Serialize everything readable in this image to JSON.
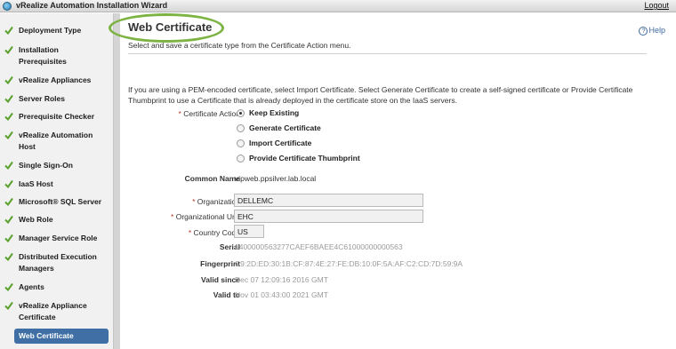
{
  "titlebar": {
    "app_title": "vRealize Automation Installation Wizard",
    "logout": "Logout"
  },
  "sidebar": {
    "items": [
      {
        "label": "Deployment Type",
        "completed": true
      },
      {
        "label": "Installation Prerequisites",
        "completed": true
      },
      {
        "label": "vRealize Appliances",
        "completed": true
      },
      {
        "label": "Server Roles",
        "completed": true
      },
      {
        "label": "Prerequisite Checker",
        "completed": true
      },
      {
        "label": "vRealize Automation Host",
        "completed": true
      },
      {
        "label": "Single Sign-On",
        "completed": true
      },
      {
        "label": "IaaS Host",
        "completed": true
      },
      {
        "label": "Microsoft® SQL Server",
        "completed": true
      },
      {
        "label": "Web Role",
        "completed": true
      },
      {
        "label": "Manager Service Role",
        "completed": true
      },
      {
        "label": "Distributed Execution Managers",
        "completed": true
      },
      {
        "label": "Agents",
        "completed": true
      },
      {
        "label": "vRealize Appliance Certificate",
        "completed": true
      },
      {
        "label": "Web Certificate",
        "active": true
      }
    ]
  },
  "page": {
    "title": "Web Certificate",
    "help": "Help",
    "subtitle": "Select and save a certificate type from the Certificate Action menu.",
    "info": "If you are using a PEM-encoded certificate, select Import Certificate. Select Generate Certificate to create a self-signed certificate or Provide Certificate Thumbprint to use a Certificate that is already deployed in the certificate store on the IaaS servers."
  },
  "form": {
    "certificate_action_label": "Certificate Action",
    "options": [
      "Keep Existing",
      "Generate Certificate",
      "Import Certificate",
      "Provide Certificate Thumbprint"
    ],
    "selected_option": "Keep Existing",
    "common_name_label": "Common Name",
    "common_name": "vipweb.ppsilver.lab.local",
    "organization_label": "Organization",
    "organization": "DELLEMC",
    "org_unit_label": "Organizational Unit",
    "org_unit": "EHC",
    "country_label": "Country Code",
    "country": "US",
    "serial_label": "Serial",
    "serial": "1400000563277CAEF6BAEE4C61000000000563",
    "fingerprint_label": "Fingerprint",
    "fingerprint": "C9:2D:ED:30:1B:CF:87:4E:27:FE:DB:10:0F:5A:AF:C2:CD:7D:59:9A",
    "valid_since_label": "Valid since",
    "valid_since": "Dec 07 12:09:16 2016 GMT",
    "valid_to_label": "Valid to",
    "valid_to": "Nov 01 03:43:00 2021 GMT"
  },
  "colors": {
    "accent": "#3f6fa5",
    "check": "#5aa02c",
    "highlight_ring": "#7cb342",
    "required": "#c0392b"
  },
  "icons": {
    "app": "vrealize-logo-icon",
    "completed": "checkmark-icon",
    "help": "help-circle-icon"
  }
}
